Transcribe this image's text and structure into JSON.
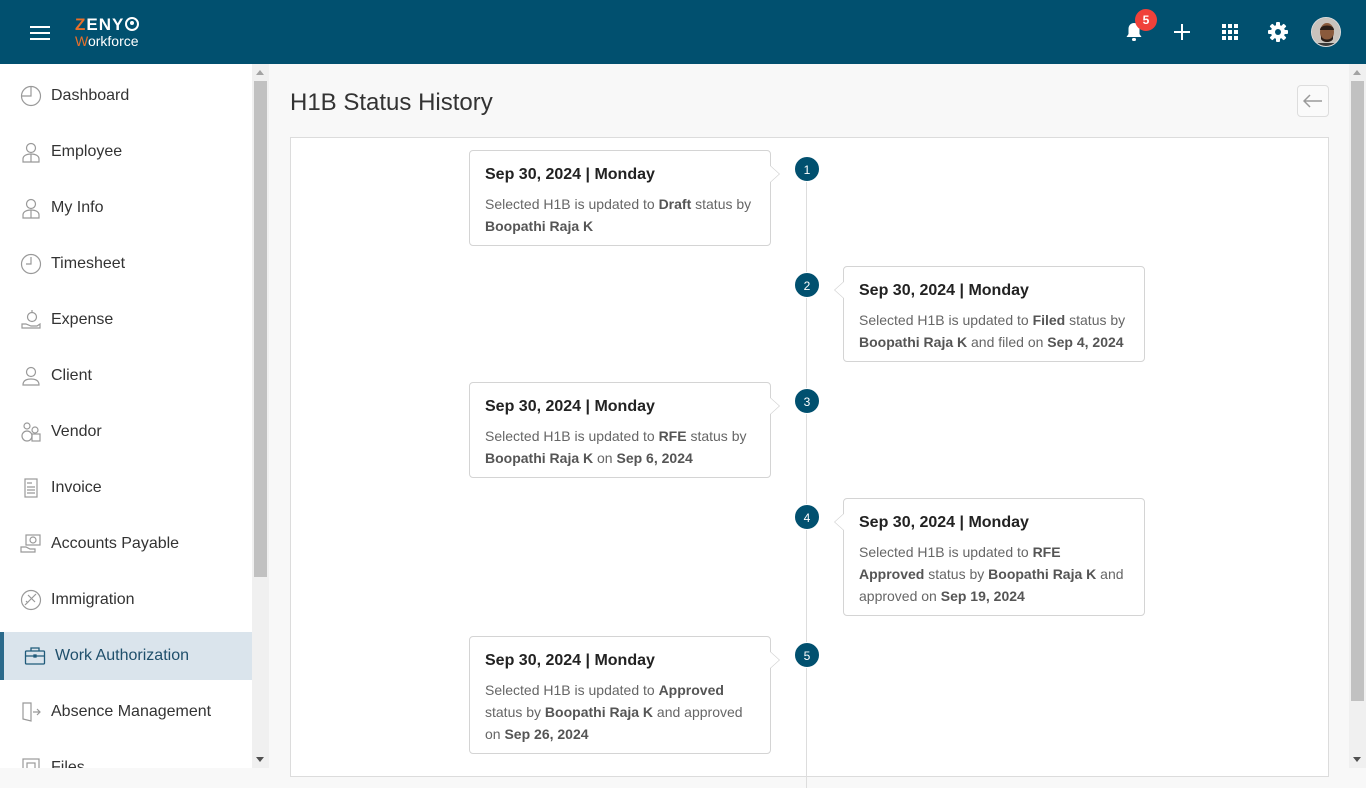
{
  "header": {
    "logo_top": "ZENY",
    "logo_top_first": "Z",
    "logo_top_rest": "ENY",
    "logo_bottom_first": "W",
    "logo_bottom_rest": "orkforce",
    "notification_count": "5",
    "icons": [
      "menu-icon",
      "bell-icon",
      "plus-icon",
      "apps-grid-icon",
      "gear-icon",
      "user-avatar"
    ]
  },
  "sidebar": {
    "items": [
      {
        "label": "Dashboard",
        "icon": "dashboard-icon"
      },
      {
        "label": "Employee",
        "icon": "employee-icon"
      },
      {
        "label": "My Info",
        "icon": "my-info-icon"
      },
      {
        "label": "Timesheet",
        "icon": "clock-icon"
      },
      {
        "label": "Expense",
        "icon": "expense-icon"
      },
      {
        "label": "Client",
        "icon": "client-icon"
      },
      {
        "label": "Vendor",
        "icon": "vendor-icon"
      },
      {
        "label": "Invoice",
        "icon": "invoice-icon"
      },
      {
        "label": "Accounts Payable",
        "icon": "accounts-payable-icon"
      },
      {
        "label": "Immigration",
        "icon": "immigration-icon"
      },
      {
        "label": "Work Authorization",
        "icon": "briefcase-icon",
        "active": true
      },
      {
        "label": "Absence Management",
        "icon": "absence-icon"
      },
      {
        "label": "Files",
        "icon": "files-icon"
      }
    ]
  },
  "page": {
    "title": "H1B Status History",
    "back_icon": "arrow-left-icon"
  },
  "colors": {
    "brand": "#01506f",
    "accent": "#e8702a",
    "badge": "#f0413a",
    "active_bg": "#dae4ec"
  },
  "timeline": [
    {
      "step": "1",
      "date": "Sep 30, 2024 | Monday",
      "parts": [
        [
          "Selected H1B is updated to ",
          false
        ],
        [
          "Draft",
          true
        ],
        [
          " status by ",
          false
        ],
        [
          "Boopathi Raja K",
          true
        ]
      ]
    },
    {
      "step": "2",
      "date": "Sep 30, 2024 | Monday",
      "parts": [
        [
          "Selected H1B is updated to ",
          false
        ],
        [
          "Filed",
          true
        ],
        [
          " status by ",
          false
        ],
        [
          "Boopathi Raja K",
          true
        ],
        [
          " and filed on ",
          false
        ],
        [
          "Sep 4, 2024",
          true
        ]
      ]
    },
    {
      "step": "3",
      "date": "Sep 30, 2024 | Monday",
      "parts": [
        [
          "Selected H1B is updated to ",
          false
        ],
        [
          "RFE",
          true
        ],
        [
          " status by ",
          false
        ],
        [
          "Boopathi Raja K",
          true
        ],
        [
          " on ",
          false
        ],
        [
          "Sep 6, 2024",
          true
        ]
      ]
    },
    {
      "step": "4",
      "date": "Sep 30, 2024 | Monday",
      "parts": [
        [
          "Selected H1B is updated to ",
          false
        ],
        [
          "RFE Approved",
          true
        ],
        [
          " status by ",
          false
        ],
        [
          "Boopathi Raja K",
          true
        ],
        [
          " and approved on ",
          false
        ],
        [
          "Sep 19, 2024",
          true
        ]
      ]
    },
    {
      "step": "5",
      "date": "Sep 30, 2024 | Monday",
      "parts": [
        [
          "Selected H1B is updated to ",
          false
        ],
        [
          "Approved",
          true
        ],
        [
          " status by ",
          false
        ],
        [
          "Boopathi Raja K",
          true
        ],
        [
          " and approved on ",
          false
        ],
        [
          "Sep 26, 2024",
          true
        ]
      ]
    }
  ]
}
